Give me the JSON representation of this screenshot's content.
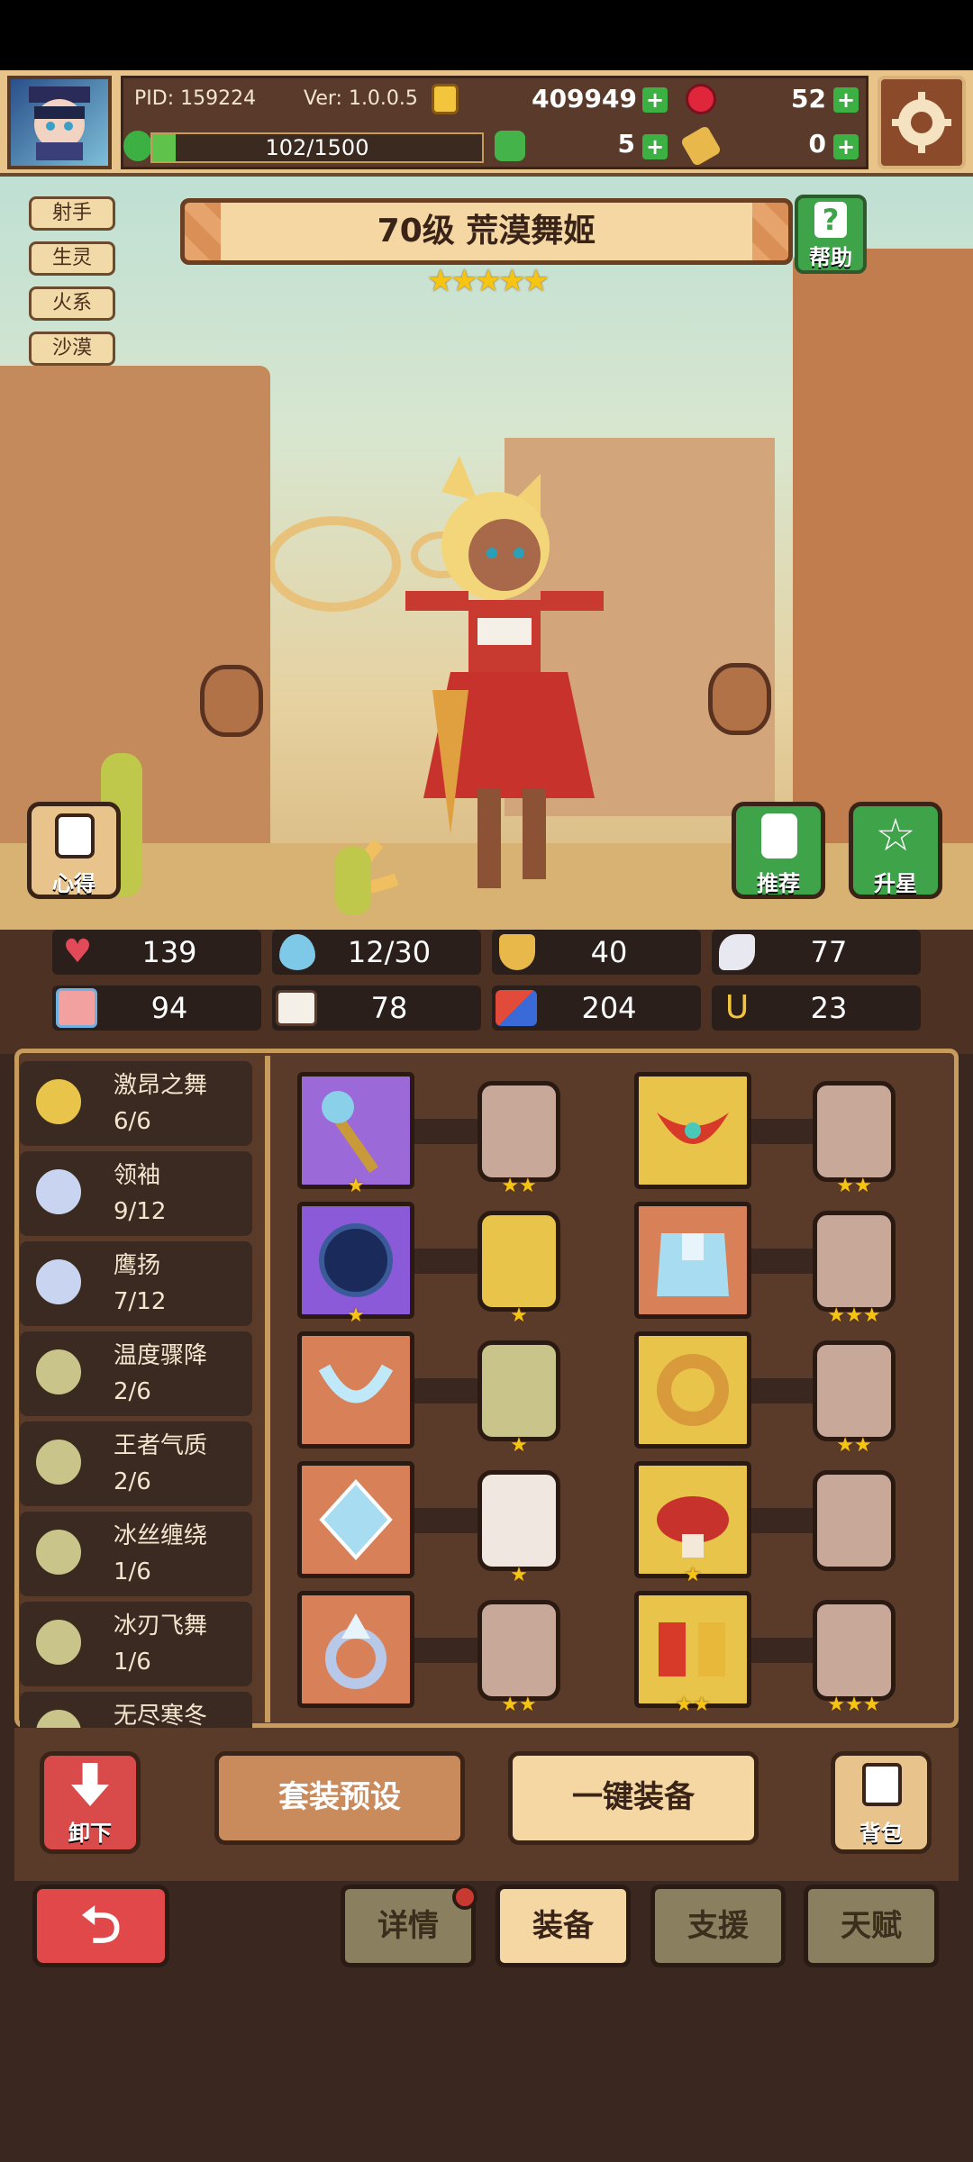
{
  "header": {
    "pid": "PID: 159224",
    "version": "Ver: 1.0.0.5",
    "gold": "409949",
    "ruby": "52",
    "exp": "102/1500",
    "clover": "5",
    "key": "0"
  },
  "hero": {
    "title": "70级 荒漠舞姬",
    "stars": "★★★★★",
    "tags": [
      "射手",
      "生灵",
      "火系",
      "沙漠"
    ]
  },
  "buttons": {
    "help": "帮助",
    "notes": "心得",
    "recommend": "推荐",
    "star_up": "升星",
    "unequip": "卸下",
    "preset": "套装预设",
    "auto_equip": "一键装备",
    "bag": "背包"
  },
  "stats": [
    "139",
    "12/30",
    "40",
    "77",
    "94",
    "78",
    "204",
    "23"
  ],
  "sets": [
    {
      "name": "激昂之舞",
      "count": "6/6"
    },
    {
      "name": "领袖",
      "count": "9/12"
    },
    {
      "name": "鹰扬",
      "count": "7/12"
    },
    {
      "name": "温度骤降",
      "count": "2/6"
    },
    {
      "name": "王者气质",
      "count": "2/6"
    },
    {
      "name": "冰丝缠绕",
      "count": "1/6"
    },
    {
      "name": "冰刃飞舞",
      "count": "1/6"
    },
    {
      "name": "无尽寒冬",
      "count": ""
    }
  ],
  "slot_stars": {
    "left_items": [
      "★",
      "★",
      "",
      "",
      ""
    ],
    "left_gems": [
      "★★",
      "★",
      "★",
      "★",
      "★★"
    ],
    "right_items": [
      "",
      "",
      "",
      "★",
      "★★"
    ],
    "right_gems": [
      "★★",
      "★★★",
      "★★",
      "",
      "★★★"
    ]
  },
  "tabs": [
    "详情",
    "装备",
    "支援",
    "天赋"
  ],
  "colors": {
    "panel": "#5a3a28",
    "gold_border": "#c79b5c",
    "green_btn": "#3fa34a",
    "red_btn": "#d94a4a",
    "star": "#f6c514"
  }
}
